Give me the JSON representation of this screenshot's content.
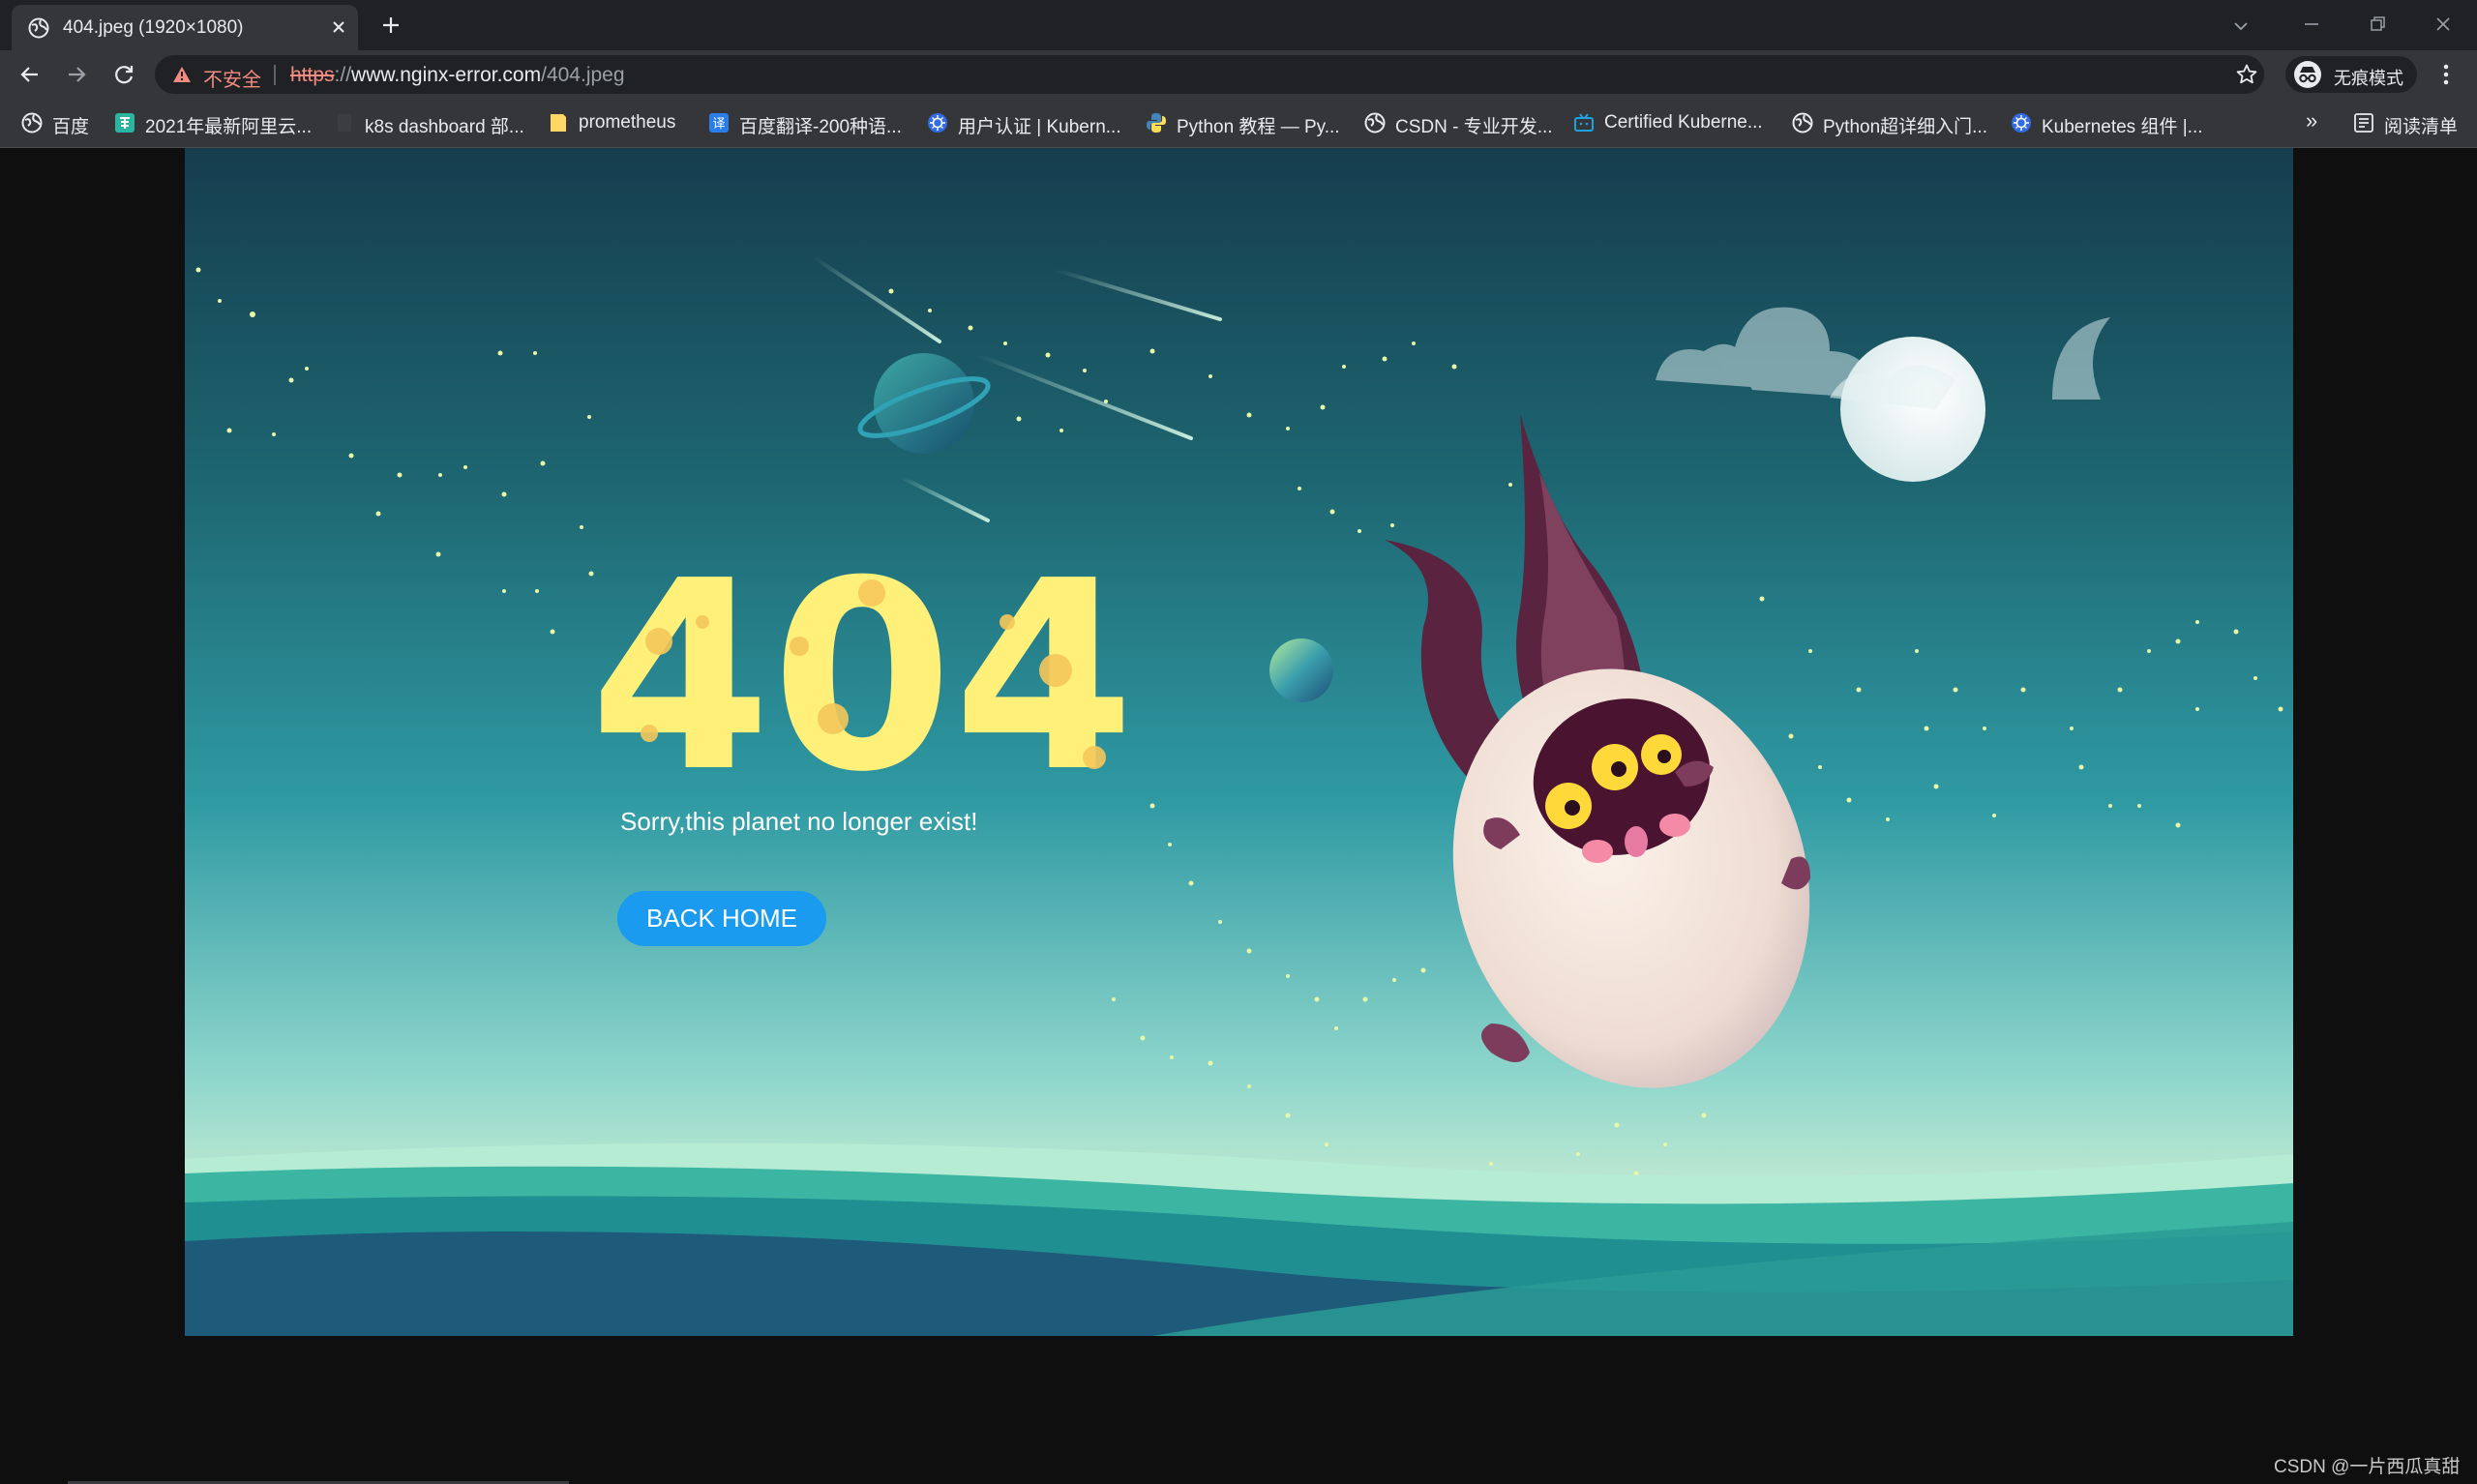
{
  "browser": {
    "tab": {
      "title": "404.jpeg (1920×1080)"
    },
    "address_bar": {
      "security_label": "不安全",
      "url_scheme": "https",
      "url_sep": "://",
      "url_host": "www.nginx-error.com",
      "url_path": "/404.jpeg"
    },
    "profile": {
      "label": "无痕模式"
    },
    "bookmarks": [
      {
        "label": "百度",
        "icon": "globe-icon"
      },
      {
        "label": "2021年最新阿里云...",
        "icon": "site-favicon-icon"
      },
      {
        "label": "k8s dashboard 部...",
        "icon": "blank-page-icon"
      },
      {
        "label": "prometheus",
        "icon": "folder-icon"
      },
      {
        "label": "百度翻译-200种语...",
        "icon": "translate-icon"
      },
      {
        "label": "用户认证 | Kubern...",
        "icon": "kubernetes-icon"
      },
      {
        "label": "Python 教程 — Py...",
        "icon": "python-icon"
      },
      {
        "label": "CSDN - 专业开发...",
        "icon": "globe-icon"
      },
      {
        "label": "Certified Kuberne...",
        "icon": "tv-icon"
      },
      {
        "label": "Python超详细入门...",
        "icon": "globe-icon"
      },
      {
        "label": "Kubernetes 组件 |...",
        "icon": "kubernetes-icon"
      }
    ],
    "bookmarks_overflow": "»",
    "reading_list": "阅读清单"
  },
  "page": {
    "subtitle": "Sorry,this planet no longer exist!",
    "back_button": "BACK HOME",
    "error_code": "404"
  },
  "watermark": "CSDN @一片西瓜真甜",
  "colors": {
    "chrome_dark": "#202124",
    "chrome_toolbar": "#35363a",
    "insecure_red": "#f28b82",
    "button_blue": "#1a9bef",
    "digit_yellow": "#fff07a"
  }
}
